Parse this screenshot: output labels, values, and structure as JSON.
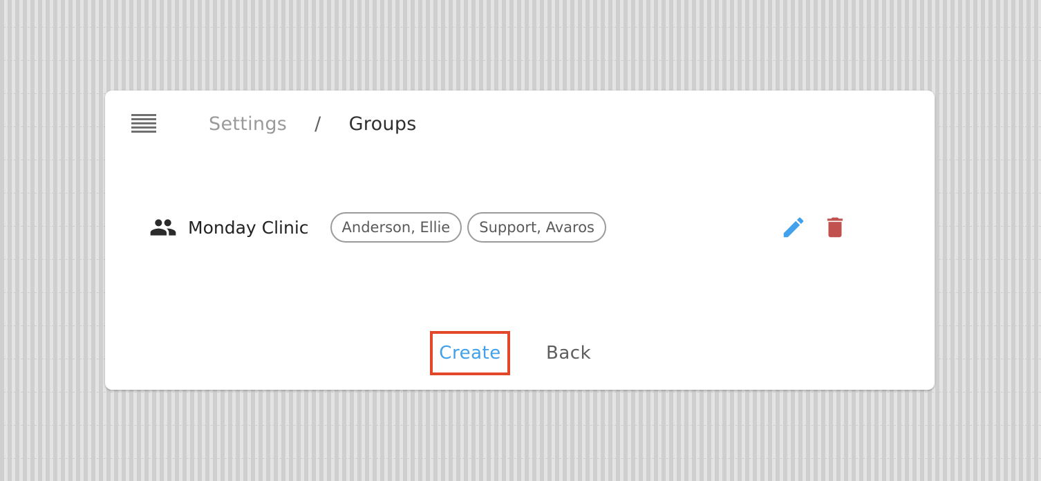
{
  "breadcrumb": {
    "parent": "Settings",
    "separator": "/",
    "current": "Groups"
  },
  "groups": [
    {
      "name": "Monday Clinic",
      "members": [
        "Anderson, Ellie",
        "Support, Avaros"
      ]
    }
  ],
  "actions": {
    "create_label": "Create",
    "back_label": "Back"
  },
  "icons": {
    "menu": "menu-icon",
    "group": "group-icon",
    "edit": "edit-icon",
    "delete": "delete-icon"
  },
  "colors": {
    "background": "#e4e4e4",
    "card": "#ffffff",
    "primary": "#42a1ea",
    "danger": "#c0514f",
    "highlight_border": "#e2472a"
  }
}
